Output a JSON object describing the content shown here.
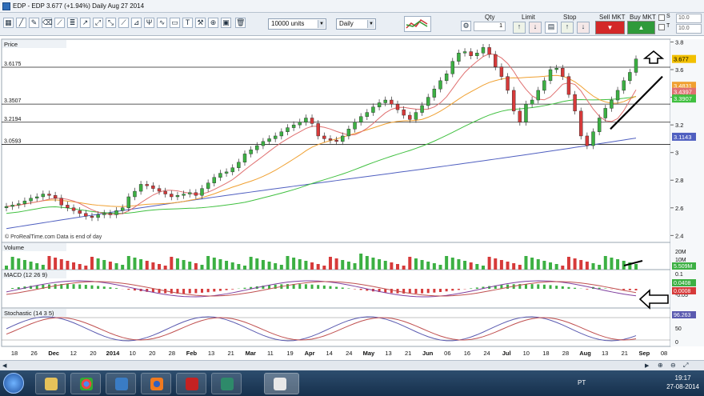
{
  "window": {
    "title": "EDP - EDP    3.677 (+1.94%)    Daily   Aug 27 2014"
  },
  "toolbar": {
    "quantity_value": "10000 units",
    "period_value": "Daily",
    "qty_label": "Qty",
    "qty_value": "1",
    "limit_label": "Limit",
    "stop_label": "Stop",
    "sell_label": "Sell MKT",
    "buy_label": "Buy MKT",
    "right_fields": [
      "10.0",
      "10.0",
      "10.0"
    ],
    "right_options": [
      "S",
      "T"
    ]
  },
  "price_panel": {
    "label": "Price",
    "current_price": "3.677",
    "levels": [
      {
        "label": "3.6175",
        "value": 3.6175
      },
      {
        "label": "3.3507",
        "value": 3.3507
      },
      {
        "label": "3.2194",
        "value": 3.2194
      },
      {
        "label": "3.0593",
        "value": 3.0593
      }
    ],
    "right_badges": [
      {
        "text": "3.4831",
        "color": "#f0a030",
        "value": 3.4831
      },
      {
        "text": "3.4397",
        "color": "#e07070",
        "value": 3.4397
      },
      {
        "text": "3.3907",
        "color": "#40c040",
        "value": 3.3907
      },
      {
        "text": "3.1143",
        "color": "#4f5fc0",
        "value": 3.1143
      }
    ],
    "axis_ticks": [
      "3.8",
      "3.6",
      "3.4",
      "3.2",
      "3",
      "2.8",
      "2.6",
      "2.4"
    ],
    "footnote": "© ProRealTime.com  Data is end of day"
  },
  "volume_panel": {
    "label": "Volume",
    "ticks": [
      "20M",
      "10M"
    ],
    "value_badge": "5.509M"
  },
  "macd_panel": {
    "label": "MACD (12 26 9)",
    "ticks": [
      "0.1",
      "0.05",
      "-0.05"
    ],
    "badges": [
      "0.0408",
      "0.0008"
    ]
  },
  "stoch_panel": {
    "label": "Stochastic (14 3 5)",
    "ticks": [
      "50",
      "0"
    ],
    "badge": "96.263"
  },
  "x_axis": [
    "18",
    "26",
    "Dec",
    "12",
    "20",
    "2014",
    "10",
    "20",
    "28",
    "Feb",
    "13",
    "21",
    "Mar",
    "11",
    "19",
    "Apr",
    "14",
    "24",
    "May",
    "13",
    "21",
    "Jun",
    "06",
    "16",
    "24",
    "Jul",
    "10",
    "18",
    "28",
    "Aug",
    "13",
    "21",
    "Sep",
    "08"
  ],
  "taskbar": {
    "lang": "PT",
    "time": "19:17",
    "date": "27-08-2014"
  },
  "chart_data": {
    "type": "candlestick",
    "title": "EDP - EDP",
    "ylim": [
      2.35,
      3.82
    ],
    "series_close": [
      2.61,
      2.62,
      2.63,
      2.65,
      2.67,
      2.68,
      2.7,
      2.69,
      2.67,
      2.62,
      2.6,
      2.58,
      2.56,
      2.54,
      2.53,
      2.55,
      2.56,
      2.55,
      2.58,
      2.6,
      2.68,
      2.72,
      2.77,
      2.76,
      2.74,
      2.72,
      2.7,
      2.68,
      2.69,
      2.7,
      2.71,
      2.69,
      2.74,
      2.78,
      2.82,
      2.85,
      2.86,
      2.89,
      2.93,
      2.99,
      3.02,
      3.05,
      3.08,
      3.1,
      3.12,
      3.15,
      3.18,
      3.2,
      3.22,
      3.25,
      3.21,
      3.12,
      3.1,
      3.09,
      3.08,
      3.12,
      3.17,
      3.22,
      3.26,
      3.29,
      3.33,
      3.36,
      3.38,
      3.35,
      3.31,
      3.27,
      3.24,
      3.29,
      3.34,
      3.4,
      3.46,
      3.52,
      3.57,
      3.66,
      3.72,
      3.73,
      3.7,
      3.72,
      3.76,
      3.71,
      3.62,
      3.55,
      3.45,
      3.3,
      3.22,
      3.35,
      3.38,
      3.45,
      3.52,
      3.6,
      3.61,
      3.55,
      3.42,
      3.3,
      3.12,
      3.05,
      3.15,
      3.25,
      3.32,
      3.38,
      3.45,
      3.52,
      3.58,
      3.677
    ]
  }
}
